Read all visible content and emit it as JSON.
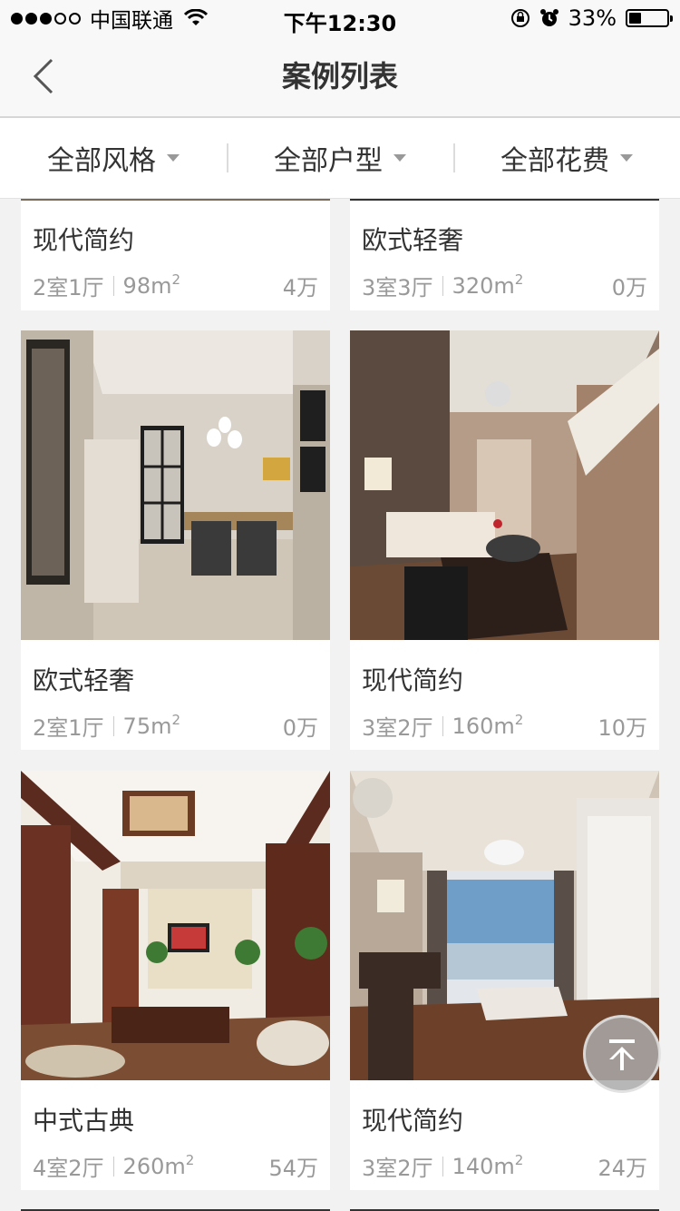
{
  "status_bar": {
    "carrier": "中国联通",
    "time": "下午12:30",
    "battery_percent": "33%",
    "battery_level": 0.33,
    "icons": [
      "signal-dots",
      "wifi-icon",
      "orientation-lock-icon",
      "alarm-icon",
      "battery-icon"
    ]
  },
  "nav": {
    "title": "案例列表",
    "back_icon": "chevron-left-icon"
  },
  "filters": [
    {
      "label": "全部风格"
    },
    {
      "label": "全部户型"
    },
    {
      "label": "全部花费"
    }
  ],
  "cases": [
    {
      "style": "现代简约",
      "rooms": "2室1厅",
      "area": "98m",
      "area_unit_sup": "2",
      "price": "4万"
    },
    {
      "style": "欧式轻奢",
      "rooms": "3室3厅",
      "area": "320m",
      "area_unit_sup": "2",
      "price": "0万"
    },
    {
      "style": "欧式轻奢",
      "rooms": "2室1厅",
      "area": "75m",
      "area_unit_sup": "2",
      "price": "0万"
    },
    {
      "style": "现代简约",
      "rooms": "3室2厅",
      "area": "160m",
      "area_unit_sup": "2",
      "price": "10万"
    },
    {
      "style": "中式古典",
      "rooms": "4室2厅",
      "area": "260m",
      "area_unit_sup": "2",
      "price": "54万"
    },
    {
      "style": "现代简约",
      "rooms": "3室2厅",
      "area": "140m",
      "area_unit_sup": "2",
      "price": "24万"
    }
  ],
  "back_to_top": {
    "icon": "arrow-up-to-top-icon"
  }
}
